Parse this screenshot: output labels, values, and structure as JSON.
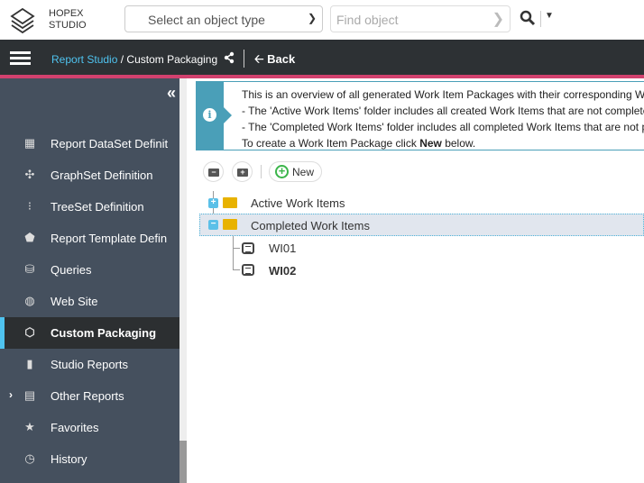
{
  "header": {
    "brand_line1": "HOPEX",
    "brand_line2": "STUDIO",
    "object_type_placeholder": "Select an object type",
    "find_placeholder": "Find object"
  },
  "navbar": {
    "breadcrumb_root": "Report Studio",
    "breadcrumb_sep": "/",
    "breadcrumb_current": "Custom Packaging",
    "back_label": "Back"
  },
  "sidebar": {
    "items": [
      {
        "label": "Report DataSet Definit",
        "icon": "grid-gear-icon"
      },
      {
        "label": "GraphSet Definition",
        "icon": "graph-icon"
      },
      {
        "label": "TreeSet Definition",
        "icon": "tree-icon"
      },
      {
        "label": "Report Template Defin",
        "icon": "pentagon-icon"
      },
      {
        "label": "Queries",
        "icon": "query-icon"
      },
      {
        "label": "Web Site",
        "icon": "globe-icon"
      },
      {
        "label": "Custom Packaging",
        "icon": "package-icon",
        "active": true
      },
      {
        "label": "Studio Reports",
        "icon": "document-icon"
      },
      {
        "label": "Other Reports",
        "icon": "newspaper-icon",
        "expandable": true
      },
      {
        "label": "Favorites",
        "icon": "star-icon"
      },
      {
        "label": "History",
        "icon": "history-icon"
      }
    ]
  },
  "info": {
    "line1": "This is an overview of all generated Work Item Packages with their corresponding Work",
    "line2": " - The 'Active Work Items'  folder  includes all created Work Items that are not complete",
    "line3": " - The 'Completed Work Items'  folder  includes all completed Work Items that are not pa",
    "line4_pre": "To create a Work Item Package click ",
    "line4_bold": "New",
    "line4_post": " below."
  },
  "toolbar": {
    "new_label": "New"
  },
  "tree": {
    "folders": [
      {
        "label": "Active Work Items",
        "expanded": false
      },
      {
        "label": "Completed Work Items",
        "expanded": true,
        "children": [
          {
            "label": "WI01"
          },
          {
            "label": "WI02"
          }
        ]
      }
    ]
  },
  "colors": {
    "accent": "#4fc3ef",
    "pink": "#d2416e",
    "sidebar": "#45505e",
    "folder": "#e8b200"
  }
}
